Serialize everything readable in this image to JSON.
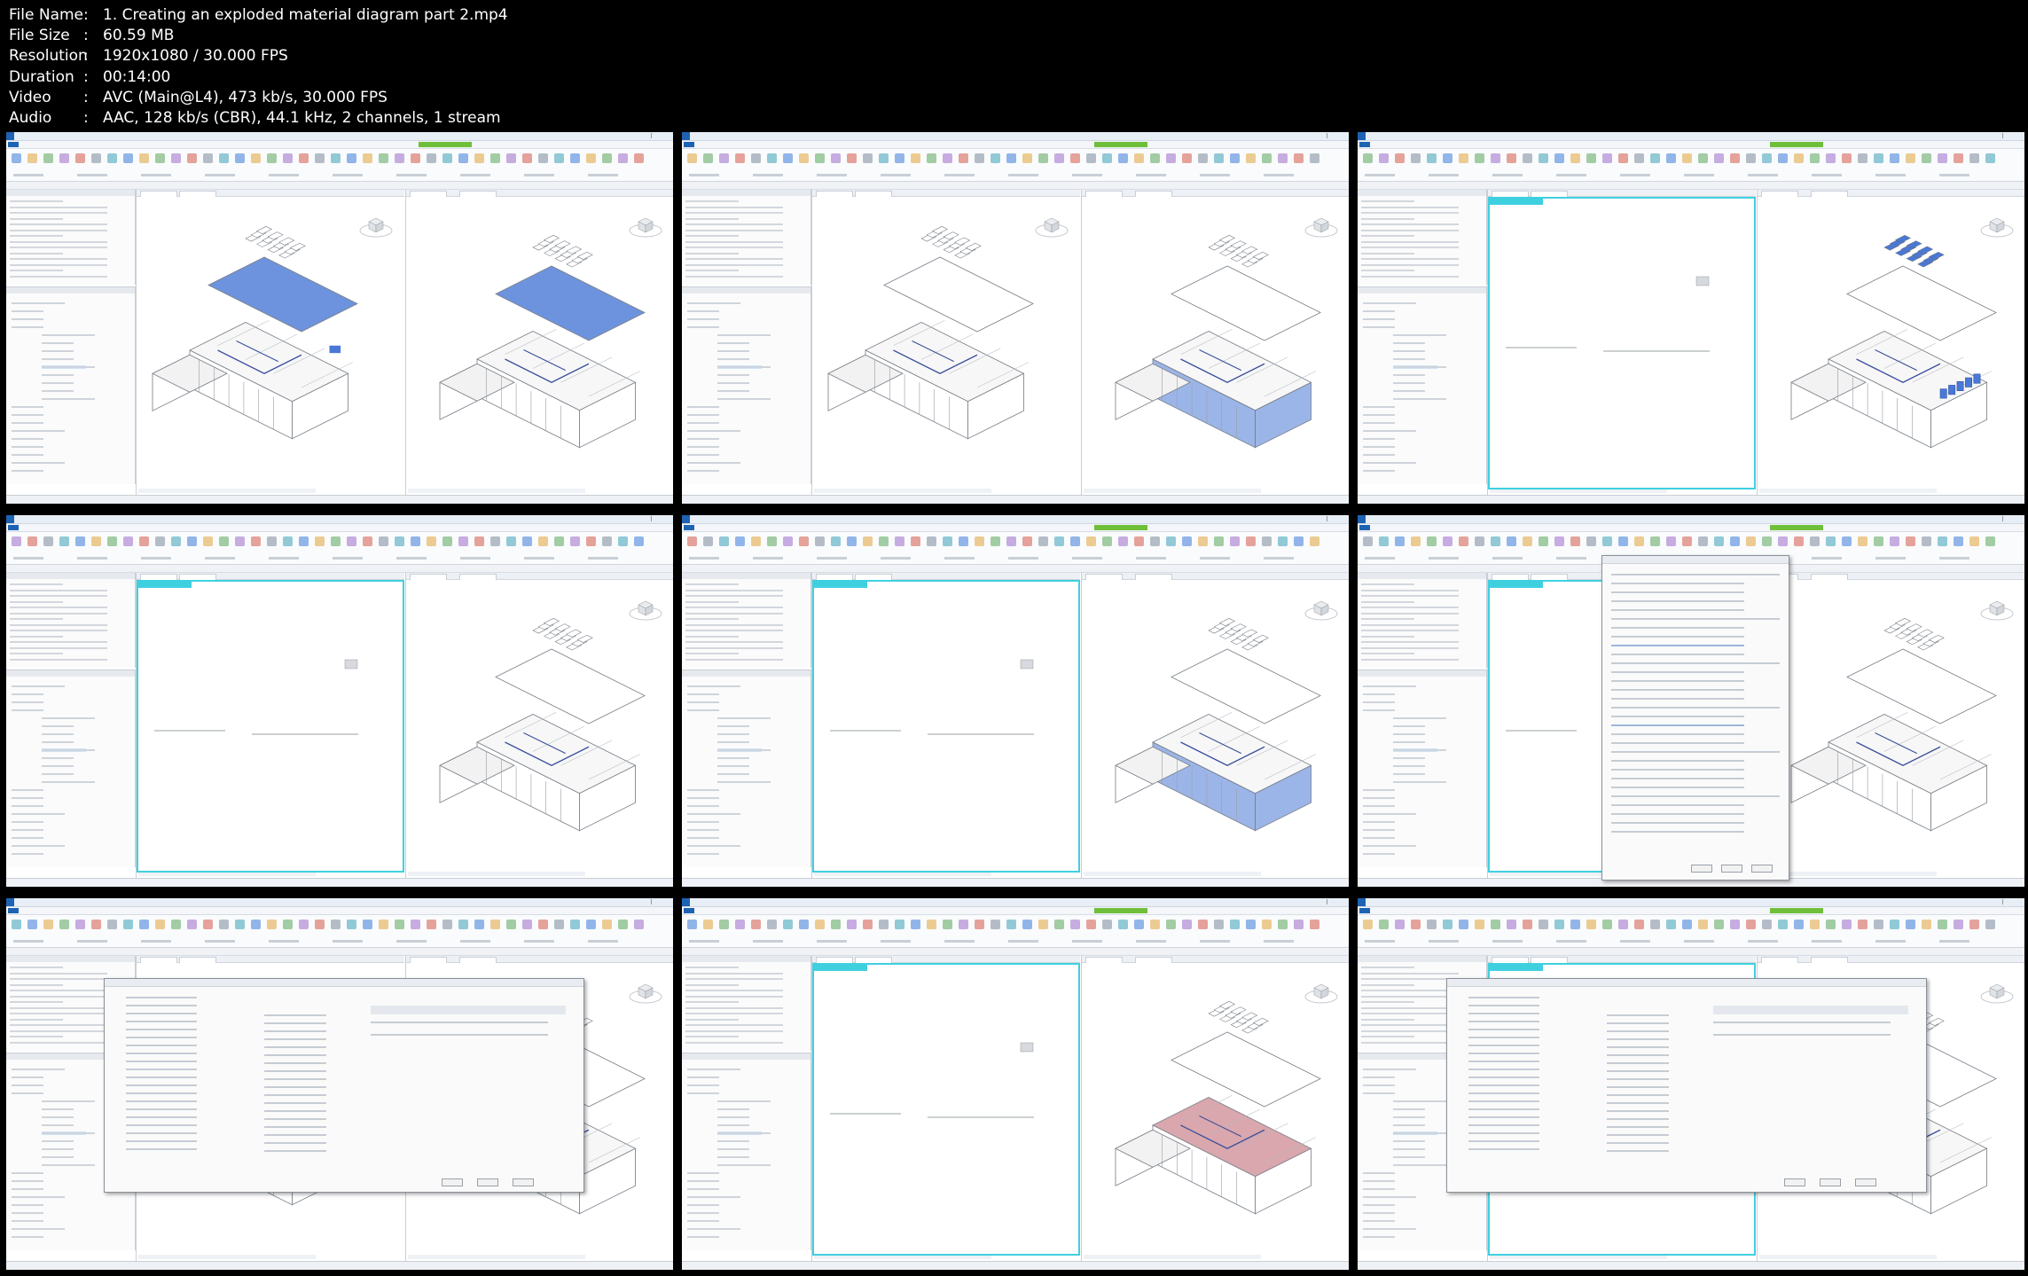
{
  "file_info": [
    {
      "key": "File Name",
      "value": "1. Creating an exploded material diagram part 2.mp4"
    },
    {
      "key": "File Size",
      "value": "60.59 MB"
    },
    {
      "key": "Resolution",
      "value": "1920x1080 / 30.000 FPS"
    },
    {
      "key": "Duration",
      "value": "00:14:00"
    },
    {
      "key": "Video",
      "value": "AVC (Main@L4), 473 kb/s, 30.000 FPS"
    },
    {
      "key": "Audio",
      "value": "AAC, 128 kb/s (CBR), 44.1 kHz, 2 channels, 1 stream"
    }
  ],
  "thumbnails": [
    {
      "id": 1,
      "state": "two-views-blue-roof"
    },
    {
      "id": 2,
      "state": "two-views-blue-walls"
    },
    {
      "id": 3,
      "state": "isolate-left-blue-windows-right"
    },
    {
      "id": 4,
      "state": "isolate-left-plain-right"
    },
    {
      "id": 5,
      "state": "isolate-left-blue-walls-right"
    },
    {
      "id": 6,
      "state": "type-properties-dialog"
    },
    {
      "id": 7,
      "state": "filters-dialog"
    },
    {
      "id": 8,
      "state": "isolate-left-pink-floor-right"
    },
    {
      "id": 9,
      "state": "filters-dialog-over-vg"
    }
  ],
  "colors": {
    "background": "#000000",
    "meta_text": "#ffffff",
    "revit_blue": "#1e63b3",
    "context_green": "#6fbf3a",
    "isolate_cyan": "#3fd0e0",
    "selection_blue": "#4a78d6",
    "material_pink": "#d9a7ad"
  }
}
